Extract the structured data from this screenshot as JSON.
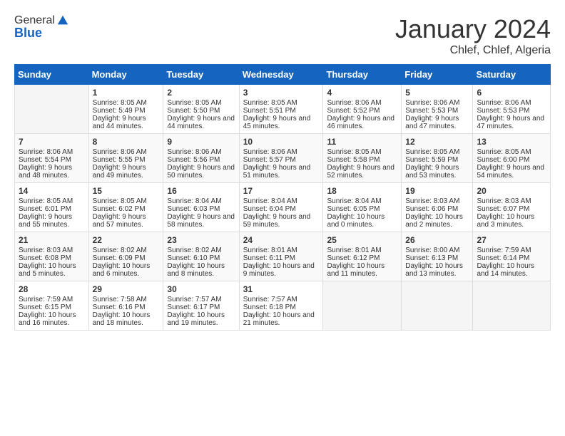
{
  "logo": {
    "general": "General",
    "blue": "Blue"
  },
  "title": "January 2024",
  "subtitle": "Chlef, Chlef, Algeria",
  "days_header": [
    "Sunday",
    "Monday",
    "Tuesday",
    "Wednesday",
    "Thursday",
    "Friday",
    "Saturday"
  ],
  "weeks": [
    [
      {
        "num": "",
        "sunrise": "",
        "sunset": "",
        "daylight": ""
      },
      {
        "num": "1",
        "sunrise": "Sunrise: 8:05 AM",
        "sunset": "Sunset: 5:49 PM",
        "daylight": "Daylight: 9 hours and 44 minutes."
      },
      {
        "num": "2",
        "sunrise": "Sunrise: 8:05 AM",
        "sunset": "Sunset: 5:50 PM",
        "daylight": "Daylight: 9 hours and 44 minutes."
      },
      {
        "num": "3",
        "sunrise": "Sunrise: 8:05 AM",
        "sunset": "Sunset: 5:51 PM",
        "daylight": "Daylight: 9 hours and 45 minutes."
      },
      {
        "num": "4",
        "sunrise": "Sunrise: 8:06 AM",
        "sunset": "Sunset: 5:52 PM",
        "daylight": "Daylight: 9 hours and 46 minutes."
      },
      {
        "num": "5",
        "sunrise": "Sunrise: 8:06 AM",
        "sunset": "Sunset: 5:53 PM",
        "daylight": "Daylight: 9 hours and 47 minutes."
      },
      {
        "num": "6",
        "sunrise": "Sunrise: 8:06 AM",
        "sunset": "Sunset: 5:53 PM",
        "daylight": "Daylight: 9 hours and 47 minutes."
      }
    ],
    [
      {
        "num": "7",
        "sunrise": "Sunrise: 8:06 AM",
        "sunset": "Sunset: 5:54 PM",
        "daylight": "Daylight: 9 hours and 48 minutes."
      },
      {
        "num": "8",
        "sunrise": "Sunrise: 8:06 AM",
        "sunset": "Sunset: 5:55 PM",
        "daylight": "Daylight: 9 hours and 49 minutes."
      },
      {
        "num": "9",
        "sunrise": "Sunrise: 8:06 AM",
        "sunset": "Sunset: 5:56 PM",
        "daylight": "Daylight: 9 hours and 50 minutes."
      },
      {
        "num": "10",
        "sunrise": "Sunrise: 8:06 AM",
        "sunset": "Sunset: 5:57 PM",
        "daylight": "Daylight: 9 hours and 51 minutes."
      },
      {
        "num": "11",
        "sunrise": "Sunrise: 8:05 AM",
        "sunset": "Sunset: 5:58 PM",
        "daylight": "Daylight: 9 hours and 52 minutes."
      },
      {
        "num": "12",
        "sunrise": "Sunrise: 8:05 AM",
        "sunset": "Sunset: 5:59 PM",
        "daylight": "Daylight: 9 hours and 53 minutes."
      },
      {
        "num": "13",
        "sunrise": "Sunrise: 8:05 AM",
        "sunset": "Sunset: 6:00 PM",
        "daylight": "Daylight: 9 hours and 54 minutes."
      }
    ],
    [
      {
        "num": "14",
        "sunrise": "Sunrise: 8:05 AM",
        "sunset": "Sunset: 6:01 PM",
        "daylight": "Daylight: 9 hours and 55 minutes."
      },
      {
        "num": "15",
        "sunrise": "Sunrise: 8:05 AM",
        "sunset": "Sunset: 6:02 PM",
        "daylight": "Daylight: 9 hours and 57 minutes."
      },
      {
        "num": "16",
        "sunrise": "Sunrise: 8:04 AM",
        "sunset": "Sunset: 6:03 PM",
        "daylight": "Daylight: 9 hours and 58 minutes."
      },
      {
        "num": "17",
        "sunrise": "Sunrise: 8:04 AM",
        "sunset": "Sunset: 6:04 PM",
        "daylight": "Daylight: 9 hours and 59 minutes."
      },
      {
        "num": "18",
        "sunrise": "Sunrise: 8:04 AM",
        "sunset": "Sunset: 6:05 PM",
        "daylight": "Daylight: 10 hours and 0 minutes."
      },
      {
        "num": "19",
        "sunrise": "Sunrise: 8:03 AM",
        "sunset": "Sunset: 6:06 PM",
        "daylight": "Daylight: 10 hours and 2 minutes."
      },
      {
        "num": "20",
        "sunrise": "Sunrise: 8:03 AM",
        "sunset": "Sunset: 6:07 PM",
        "daylight": "Daylight: 10 hours and 3 minutes."
      }
    ],
    [
      {
        "num": "21",
        "sunrise": "Sunrise: 8:03 AM",
        "sunset": "Sunset: 6:08 PM",
        "daylight": "Daylight: 10 hours and 5 minutes."
      },
      {
        "num": "22",
        "sunrise": "Sunrise: 8:02 AM",
        "sunset": "Sunset: 6:09 PM",
        "daylight": "Daylight: 10 hours and 6 minutes."
      },
      {
        "num": "23",
        "sunrise": "Sunrise: 8:02 AM",
        "sunset": "Sunset: 6:10 PM",
        "daylight": "Daylight: 10 hours and 8 minutes."
      },
      {
        "num": "24",
        "sunrise": "Sunrise: 8:01 AM",
        "sunset": "Sunset: 6:11 PM",
        "daylight": "Daylight: 10 hours and 9 minutes."
      },
      {
        "num": "25",
        "sunrise": "Sunrise: 8:01 AM",
        "sunset": "Sunset: 6:12 PM",
        "daylight": "Daylight: 10 hours and 11 minutes."
      },
      {
        "num": "26",
        "sunrise": "Sunrise: 8:00 AM",
        "sunset": "Sunset: 6:13 PM",
        "daylight": "Daylight: 10 hours and 13 minutes."
      },
      {
        "num": "27",
        "sunrise": "Sunrise: 7:59 AM",
        "sunset": "Sunset: 6:14 PM",
        "daylight": "Daylight: 10 hours and 14 minutes."
      }
    ],
    [
      {
        "num": "28",
        "sunrise": "Sunrise: 7:59 AM",
        "sunset": "Sunset: 6:15 PM",
        "daylight": "Daylight: 10 hours and 16 minutes."
      },
      {
        "num": "29",
        "sunrise": "Sunrise: 7:58 AM",
        "sunset": "Sunset: 6:16 PM",
        "daylight": "Daylight: 10 hours and 18 minutes."
      },
      {
        "num": "30",
        "sunrise": "Sunrise: 7:57 AM",
        "sunset": "Sunset: 6:17 PM",
        "daylight": "Daylight: 10 hours and 19 minutes."
      },
      {
        "num": "31",
        "sunrise": "Sunrise: 7:57 AM",
        "sunset": "Sunset: 6:18 PM",
        "daylight": "Daylight: 10 hours and 21 minutes."
      },
      {
        "num": "",
        "sunrise": "",
        "sunset": "",
        "daylight": ""
      },
      {
        "num": "",
        "sunrise": "",
        "sunset": "",
        "daylight": ""
      },
      {
        "num": "",
        "sunrise": "",
        "sunset": "",
        "daylight": ""
      }
    ]
  ]
}
